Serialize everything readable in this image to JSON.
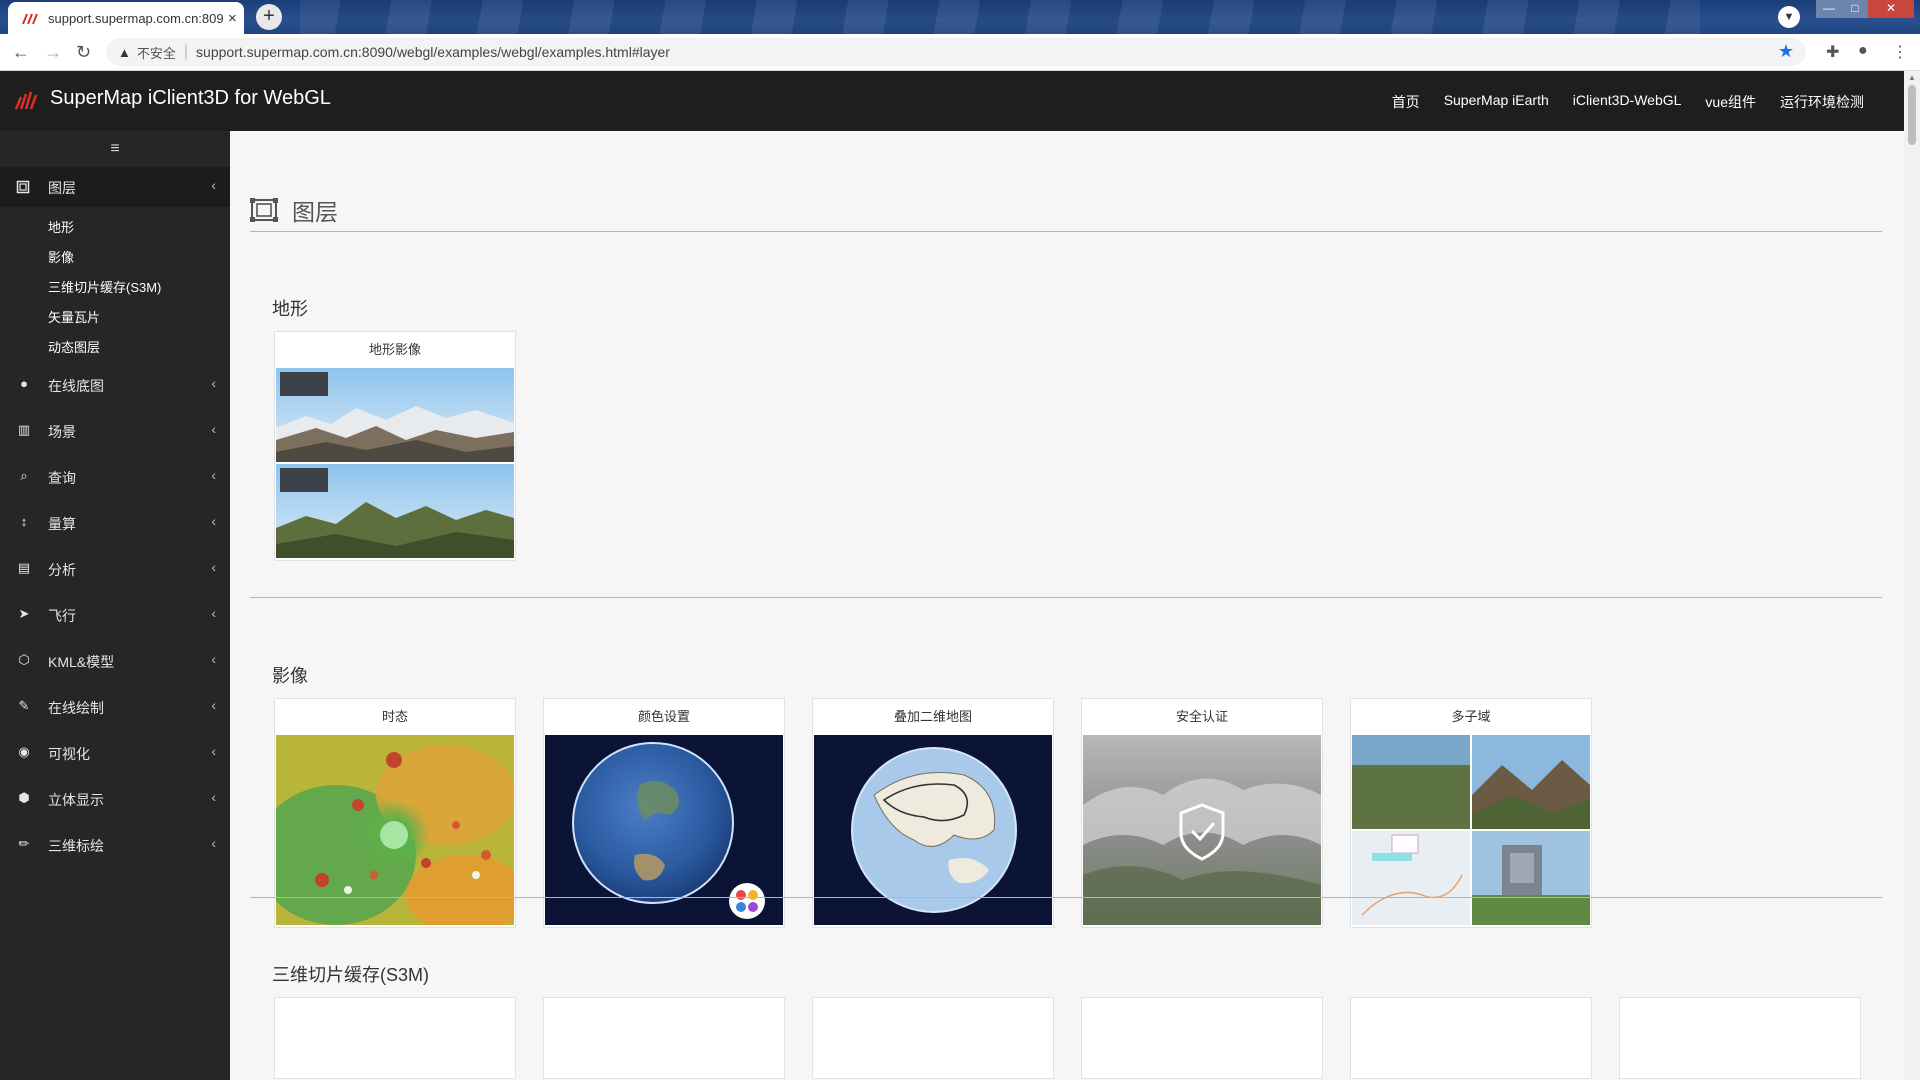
{
  "browser": {
    "tab_title": "support.supermap.com.cn:809",
    "tab_close": "×",
    "new_tab": "+",
    "insecure_label": "不安全",
    "url": "support.supermap.com.cn:8090/webgl/examples/webgl/examples.html#layer",
    "window_controls": {
      "minimize": "—",
      "maximize": "□",
      "close": "✕"
    },
    "back": "←",
    "forward": "→",
    "reload": "↻",
    "star": "★",
    "extensions": "✚",
    "profile": "●",
    "more": "⋮"
  },
  "header": {
    "brand": "SuperMap iClient3D for WebGL",
    "nav": [
      "首页",
      "SuperMap iEarth",
      "iClient3D-WebGL",
      "vue组件",
      "运行环境检测"
    ]
  },
  "sidebar": {
    "toggle": "≡",
    "active_menu": {
      "label": "图层",
      "icon": "layer-frame-icon"
    },
    "sub_items": [
      "地形",
      "影像",
      "三维切片缓存(S3M)",
      "矢量瓦片",
      "动态图层"
    ],
    "items": [
      {
        "label": "在线底图",
        "icon": "globe-icon",
        "glyph": "●"
      },
      {
        "label": "场景",
        "icon": "bank-icon",
        "glyph": "▥"
      },
      {
        "label": "查询",
        "icon": "search-icon",
        "glyph": "⌕"
      },
      {
        "label": "量算",
        "icon": "arrows-vertical-icon",
        "glyph": "↕"
      },
      {
        "label": "分析",
        "icon": "map-icon",
        "glyph": "▤"
      },
      {
        "label": "飞行",
        "icon": "paper-plane-icon",
        "glyph": "➤"
      },
      {
        "label": "KML&模型",
        "icon": "cubes-icon",
        "glyph": "⬡"
      },
      {
        "label": "在线绘制",
        "icon": "edit-icon",
        "glyph": "✎"
      },
      {
        "label": "可视化",
        "icon": "eye-icon",
        "glyph": "◉"
      },
      {
        "label": "立体显示",
        "icon": "cube-icon",
        "glyph": "⬢"
      },
      {
        "label": "三维标绘",
        "icon": "pencil-icon",
        "glyph": "✏"
      }
    ],
    "chevron": "‹"
  },
  "content": {
    "page_title": "图层",
    "sections": [
      {
        "title": "地形",
        "cards": [
          {
            "label": "地形影像",
            "thumb": "terrain"
          }
        ]
      },
      {
        "title": "影像",
        "cards": [
          {
            "label": "时态",
            "thumb": "heatmap"
          },
          {
            "label": "颜色设置",
            "thumb": "globe-color"
          },
          {
            "label": "叠加二维地图",
            "thumb": "globe-map"
          },
          {
            "label": "安全认证",
            "thumb": "security"
          },
          {
            "label": "多子域",
            "thumb": "multi"
          }
        ]
      },
      {
        "title": "三维切片缓存(S3M)",
        "cards": []
      }
    ]
  },
  "colors": {
    "header_bg": "#1e1e1e",
    "sidebar_bg": "#262626",
    "divider": "#d7a5ae",
    "logo_red": "#d9302c"
  }
}
